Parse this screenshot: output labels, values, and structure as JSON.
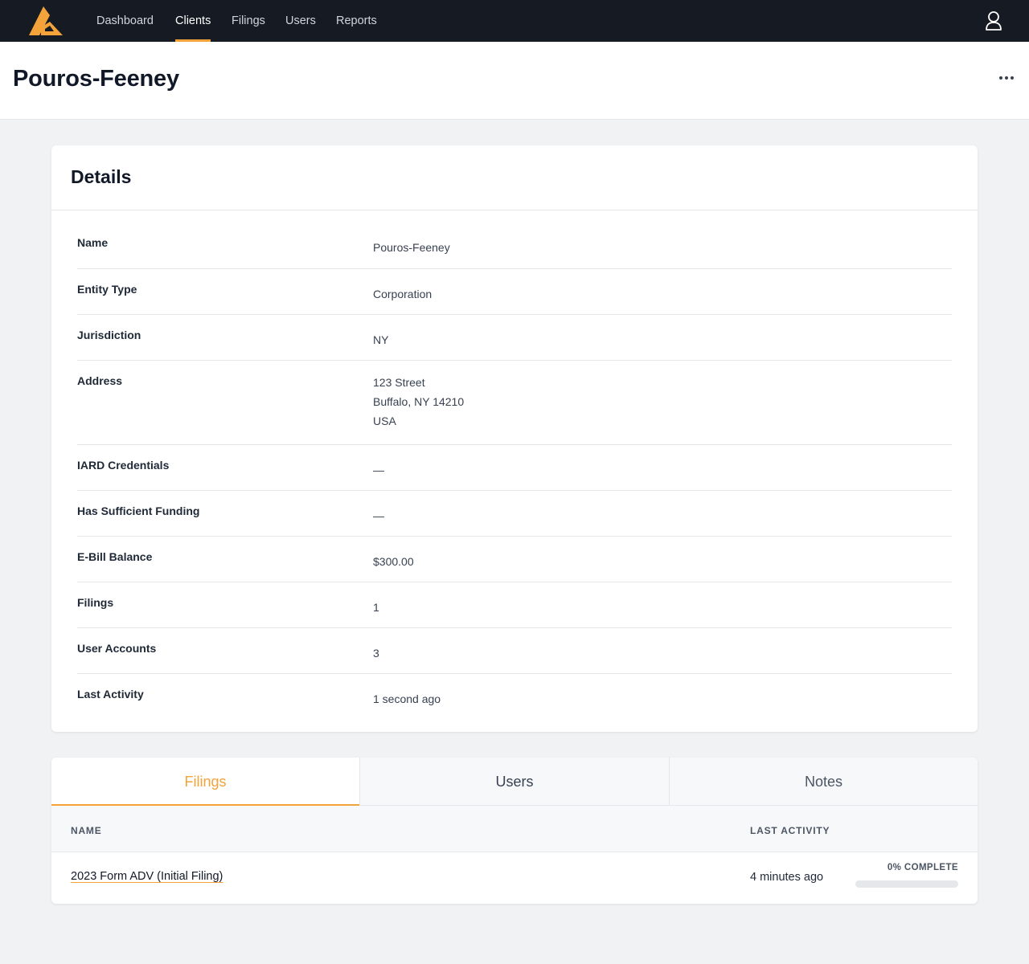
{
  "nav": {
    "items": [
      {
        "label": "Dashboard",
        "active": false
      },
      {
        "label": "Clients",
        "active": true
      },
      {
        "label": "Filings",
        "active": false
      },
      {
        "label": "Users",
        "active": false
      },
      {
        "label": "Reports",
        "active": false
      }
    ],
    "logo_icon": "logo-icon",
    "user_icon": "user-icon"
  },
  "header": {
    "title": "Pouros-Feeney",
    "more_icon": "more-horizontal-icon"
  },
  "details": {
    "title": "Details",
    "rows": [
      {
        "label": "Name",
        "value": "Pouros-Feeney"
      },
      {
        "label": "Entity Type",
        "value": "Corporation"
      },
      {
        "label": "Jurisdiction",
        "value": "NY"
      },
      {
        "label": "Address",
        "lines": [
          "123 Street",
          "Buffalo, NY 14210",
          "USA"
        ]
      },
      {
        "label": "IARD Credentials",
        "value": "—"
      },
      {
        "label": "Has Sufficient Funding",
        "value": "—"
      },
      {
        "label": "E-Bill Balance",
        "value": "$300.00"
      },
      {
        "label": "Filings",
        "value": "1"
      },
      {
        "label": "User Accounts",
        "value": "3"
      },
      {
        "label": "Last Activity",
        "value": "1 second ago"
      }
    ]
  },
  "tabs": [
    {
      "label": "Filings",
      "active": true
    },
    {
      "label": "Users",
      "active": false
    },
    {
      "label": "Notes",
      "active": false
    }
  ],
  "filings_table": {
    "columns": [
      "NAME",
      "LAST ACTIVITY"
    ],
    "rows": [
      {
        "name": "2023 Form ADV (Initial Filing)",
        "last_activity": "4 minutes ago",
        "progress_label": "0% COMPLETE",
        "progress_percent": 0
      }
    ]
  },
  "colors": {
    "accent": "#f3a33a",
    "nav_background": "#161a23",
    "page_background": "#f1f2f4"
  }
}
